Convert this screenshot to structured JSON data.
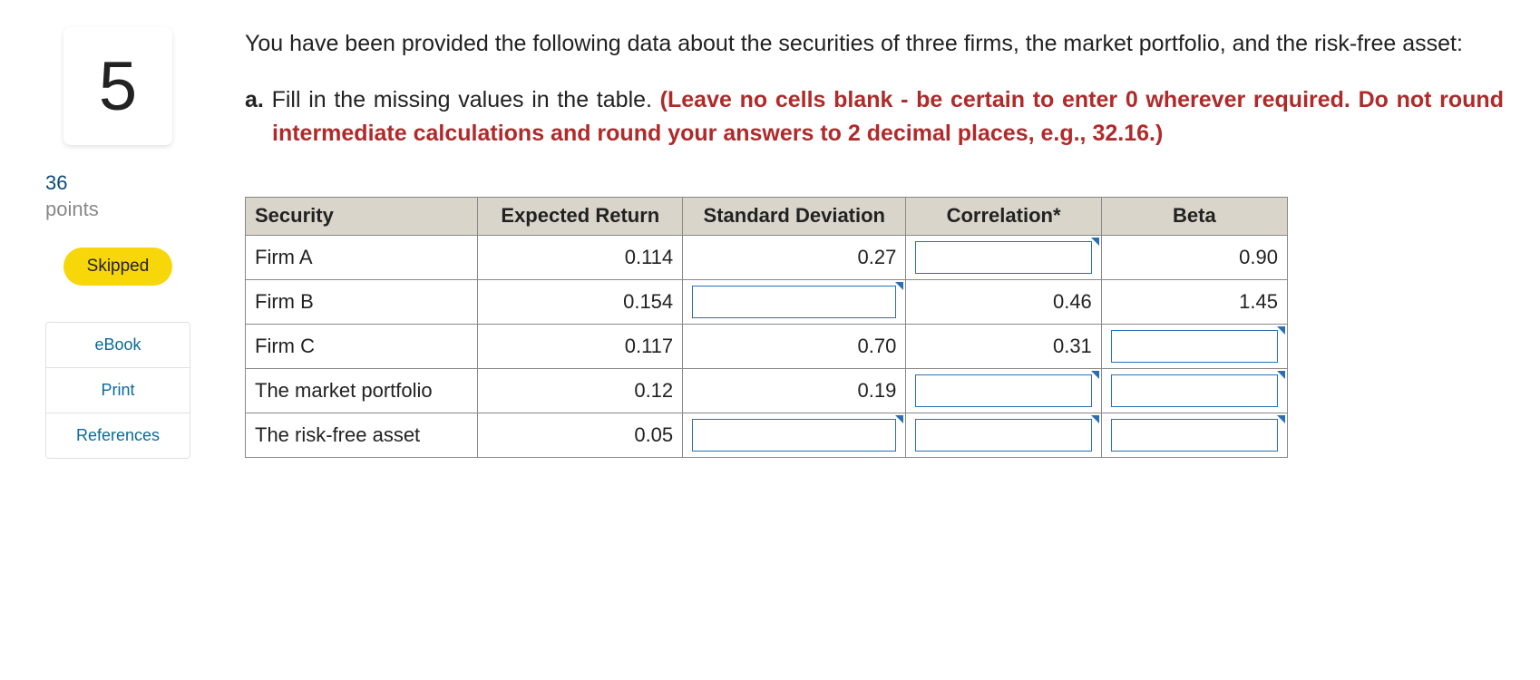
{
  "sidebar": {
    "question_number": "5",
    "points_value": "36",
    "points_label": "points",
    "skipped_label": "Skipped",
    "links": {
      "ebook": "eBook",
      "print": "Print",
      "references": "References"
    }
  },
  "prompt": {
    "intro": "You have been provided the following data about the securities of three firms, the market portfolio, and the risk-free asset:",
    "part_label": "a.",
    "part_instruction": "Fill in the missing values in the table.",
    "part_warning": "(Leave no cells blank - be certain to enter 0 wherever required. Do not round intermediate calculations and round your answers to 2 decimal places, e.g., 32.16.)"
  },
  "table": {
    "headers": {
      "security": "Security",
      "expected_return": "Expected Return",
      "std_dev": "Standard Deviation",
      "correlation": "Correlation*",
      "beta": "Beta"
    },
    "rows": [
      {
        "security": "Firm A",
        "expected_return": "0.114",
        "std_dev": "0.27",
        "correlation": null,
        "beta": "0.90"
      },
      {
        "security": "Firm B",
        "expected_return": "0.154",
        "std_dev": null,
        "correlation": "0.46",
        "beta": "1.45"
      },
      {
        "security": "Firm C",
        "expected_return": "0.117",
        "std_dev": "0.70",
        "correlation": "0.31",
        "beta": null
      },
      {
        "security": "The market portfolio",
        "expected_return": "0.12",
        "std_dev": "0.19",
        "correlation": null,
        "beta": null
      },
      {
        "security": "The risk-free asset",
        "expected_return": "0.05",
        "std_dev": null,
        "correlation": null,
        "beta": null
      }
    ]
  }
}
